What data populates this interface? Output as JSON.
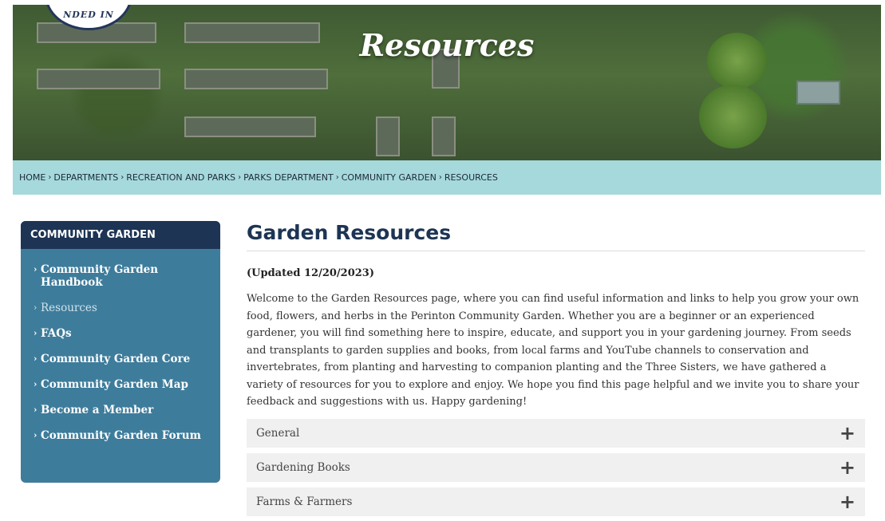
{
  "banner": {
    "title": "Resources",
    "seal_text": "NDED IN"
  },
  "breadcrumb": [
    "HOME",
    "DEPARTMENTS",
    "RECREATION AND PARKS",
    "PARKS DEPARTMENT",
    "COMMUNITY GARDEN",
    "RESOURCES"
  ],
  "sidebar": {
    "heading": "COMMUNITY GARDEN",
    "items": [
      {
        "label": "Community Garden Handbook"
      },
      {
        "label": "Resources"
      },
      {
        "label": "FAQs"
      },
      {
        "label": "Community Garden Core"
      },
      {
        "label": "Community Garden Map"
      },
      {
        "label": "Become a Member"
      },
      {
        "label": "Community Garden Forum"
      }
    ]
  },
  "main": {
    "title": "Garden Resources",
    "updated": "(Updated 12/20/2023)",
    "intro": "Welcome to the Garden Resources page, where you can find useful information and links to help you grow your own food, flowers, and herbs in the Perinton Community Garden. Whether you are a beginner or an experienced gardener, you will find something here to inspire, educate, and support you in your gardening journey. From seeds and transplants to garden supplies and books, from local farms and YouTube channels to conservation and invertebrates, from planting and harvesting to companion planting and the Three Sisters, we have gathered a variety of resources for you to explore and enjoy. We hope you find this page helpful and we invite you to share your feedback and suggestions with us. Happy gardening!",
    "accordion": [
      {
        "label": "General"
      },
      {
        "label": "Gardening Books"
      },
      {
        "label": "Farms & Farmers"
      }
    ]
  },
  "colors": {
    "navy": "#1d3454",
    "sidebar_blue": "#3e7c9b",
    "breadcrumb_teal": "#a6d9db",
    "accordion_bg": "#f0f0f0"
  },
  "icons": {
    "chevron": "chevron-right-icon",
    "accordion": "plus-icon"
  }
}
